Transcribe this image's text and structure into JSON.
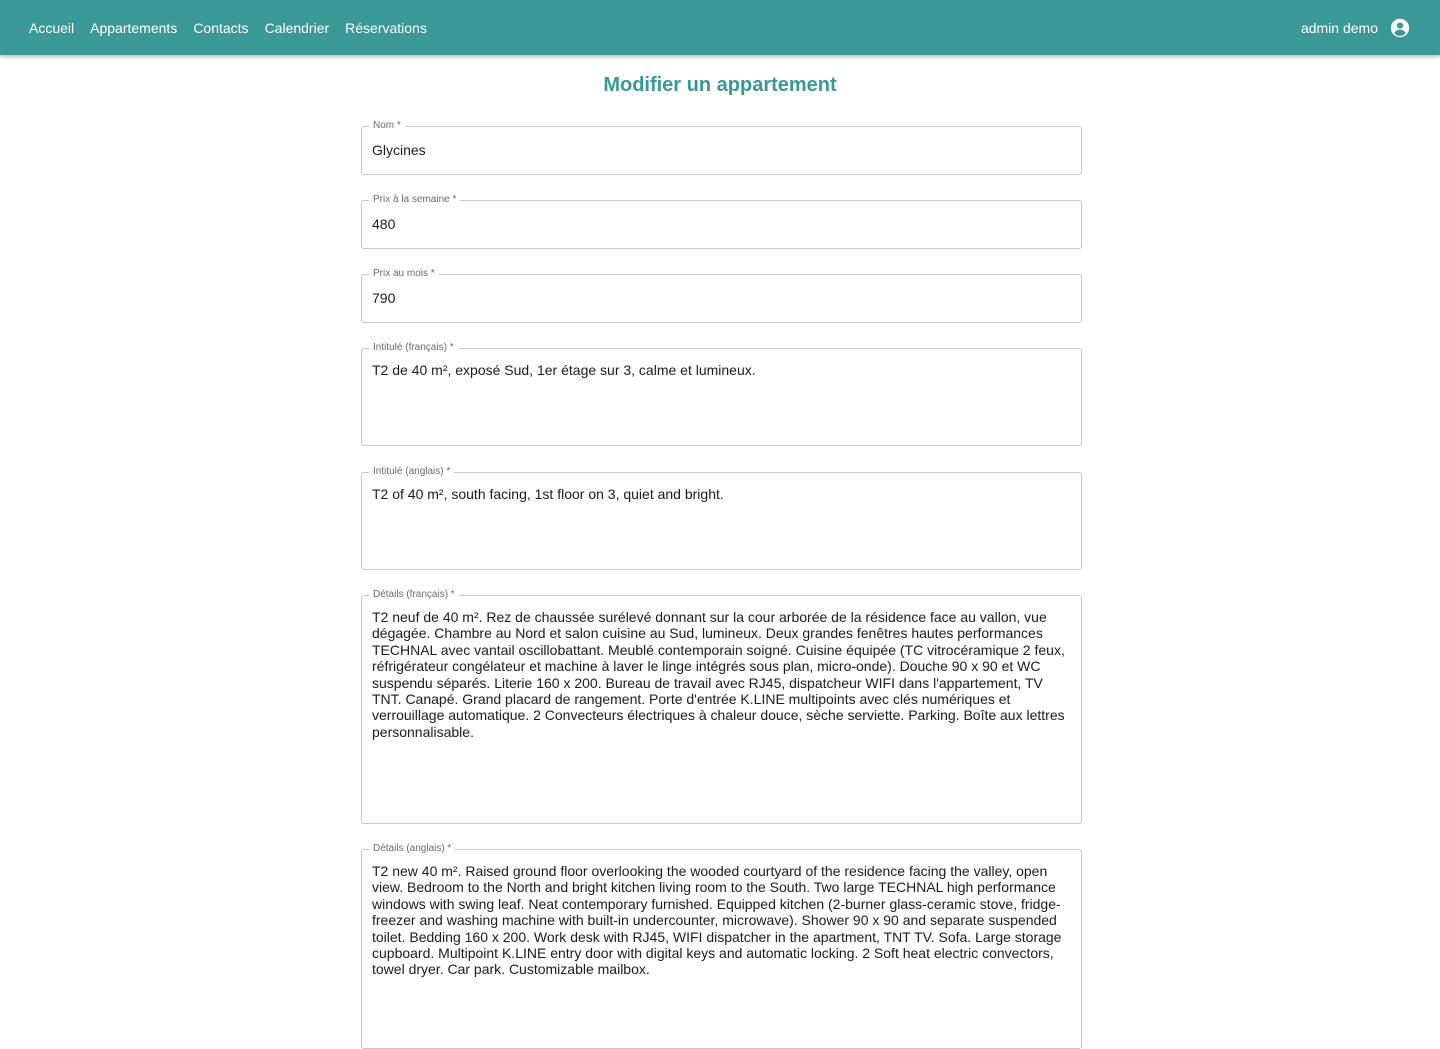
{
  "nav": {
    "items": [
      "Accueil",
      "Appartements",
      "Contacts",
      "Calendrier",
      "Réservations"
    ]
  },
  "user": {
    "name": "admin demo",
    "icon": "account-circle-icon"
  },
  "colors": {
    "primary": "#3a9896",
    "border": "#c7c7c7"
  },
  "page": {
    "title": "Modifier un appartement"
  },
  "form": {
    "nom": {
      "label": "Nom *",
      "value": "Glycines"
    },
    "prix_semaine": {
      "label": "Prix à la semaine *",
      "value": "480"
    },
    "prix_mois": {
      "label": "Prix au mois *",
      "value": "790"
    },
    "intitule_fr": {
      "label": "Intitulé (français) *",
      "value": "T2 de 40 m², exposé Sud, 1er étage sur 3, calme et lumineux."
    },
    "intitule_en": {
      "label": "Intitulé (anglais) *",
      "value": "T2 of 40 m², south facing, 1st floor on 3, quiet and bright."
    },
    "details_fr": {
      "label": "Détails (français) *",
      "value": "T2 neuf de 40 m². Rez de chaussée surélevé donnant sur la cour arborée de la résidence face au vallon, vue dégagée. Chambre au Nord et salon cuisine au Sud, lumineux. Deux grandes fenêtres hautes performances TECHNAL avec vantail oscillobattant. Meublé contemporain soigné. Cuisine équipée (TC vitrocéramique 2 feux, réfrigérateur congélateur et machine à laver le linge intégrés sous plan, micro-onde). Douche 90 x 90 et WC suspendu séparés. Literie 160 x 200. Bureau de travail avec RJ45, dispatcheur WIFI dans l'appartement, TV TNT. Canapé. Grand placard de rangement. Porte d'entrée K.LINE multipoints avec clés numériques et verrouillage automatique. 2 Convecteurs électriques à chaleur douce, sèche serviette. Parking. Boîte aux lettres personnalisable."
    },
    "details_en": {
      "label": "Détails (anglais) *",
      "value": "T2 new 40 m². Raised ground floor overlooking the wooded courtyard of the residence facing the valley, open view. Bedroom to the North and bright kitchen living room to the South. Two large TECHNAL high performance windows with swing leaf. Neat contemporary furnished. Equipped kitchen (2-burner glass-ceramic stove, fridge-freezer and washing machine with built-in undercounter, microwave). Shower 90 x 90 and separate suspended toilet. Bedding 160 x 200. Work desk with RJ45, WIFI dispatcher in the apartment, TNT TV. Sofa. Large storage cupboard. Multipoint K.LINE entry door with digital keys and automatic locking. 2 Soft heat electric convectors, towel dryer. Car park. Customizable mailbox."
    }
  }
}
